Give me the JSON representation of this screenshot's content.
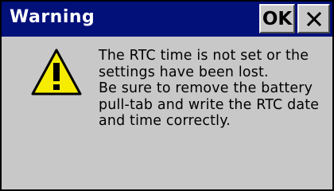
{
  "dialog": {
    "title": "Warning",
    "ok_label": "OK",
    "close_icon": "close-icon",
    "status_icon": "warning-icon",
    "message_lines": [
      "The RTC time is not set or the",
      "settings have been lost.",
      "Be sure to remove the battery",
      "pull-tab and write the RTC date",
      "and time correctly."
    ]
  },
  "colors": {
    "titlebar": "#02107a",
    "dialog_bg": "#c8c8c8",
    "title_text": "#ffffff",
    "warning_fill": "#f5ec00"
  }
}
